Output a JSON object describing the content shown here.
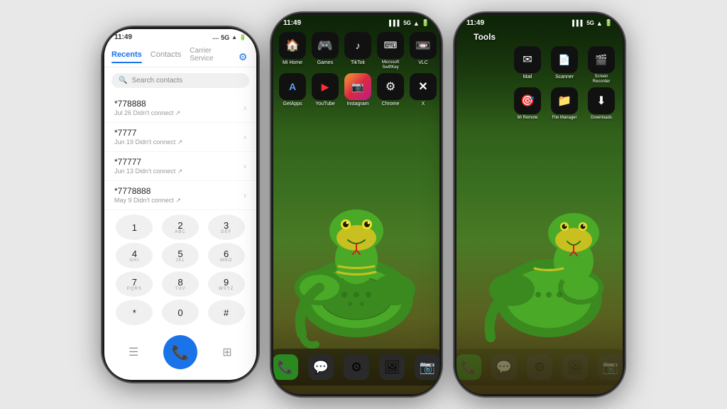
{
  "phone1": {
    "status": {
      "time": "11:49",
      "signal": "5G",
      "battery": "▓▓▓"
    },
    "tabs": [
      "Recents",
      "Contacts",
      "Carrier Service"
    ],
    "activeTab": 0,
    "searchPlaceholder": "Search contacts",
    "calls": [
      {
        "number": "*778888",
        "detail": "Jul 26 Didn't connect ↗"
      },
      {
        "number": "*7777",
        "detail": "Jun 19 Didn't connect ↗"
      },
      {
        "number": "*77777",
        "detail": "Jun 13 Didn't connect ↗"
      },
      {
        "number": "*7778888",
        "detail": "May 9 Didn't connect ↗"
      }
    ],
    "keypad": [
      [
        {
          "num": "1",
          "sub": ""
        },
        {
          "num": "2",
          "sub": "ABC"
        },
        {
          "num": "3",
          "sub": "DEF"
        }
      ],
      [
        {
          "num": "4",
          "sub": "GHI"
        },
        {
          "num": "5",
          "sub": "JKL"
        },
        {
          "num": "6",
          "sub": "MNO"
        }
      ],
      [
        {
          "num": "7",
          "sub": "PQRS"
        },
        {
          "num": "8",
          "sub": "TUV"
        },
        {
          "num": "9",
          "sub": "WXYZ"
        }
      ],
      [
        {
          "num": "*",
          "sub": ""
        },
        {
          "num": "0",
          "sub": ""
        },
        {
          "num": "#",
          "sub": ""
        }
      ]
    ]
  },
  "phone2": {
    "status": {
      "time": "11:49",
      "signal": "5G"
    },
    "apps_row1": [
      {
        "icon": "🏠",
        "label": "Mi Home"
      },
      {
        "icon": "🎮",
        "label": "Games"
      },
      {
        "icon": "♪",
        "label": "TikTok"
      },
      {
        "icon": "⌨",
        "label": "Microsoft SwiftKey"
      },
      {
        "icon": "📼",
        "label": "VLC"
      }
    ],
    "apps_row2": [
      {
        "icon": "A",
        "label": "GetApps"
      },
      {
        "icon": "▶",
        "label": "YouTube"
      },
      {
        "icon": "📷",
        "label": "Instagram"
      },
      {
        "icon": "⚙",
        "label": "Chrome"
      },
      {
        "icon": "✕",
        "label": "X"
      }
    ],
    "dock": [
      {
        "icon": "📞",
        "label": "Phone"
      },
      {
        "icon": "💬",
        "label": "Messages"
      },
      {
        "icon": "⚙",
        "label": "Settings"
      },
      {
        "icon": "🖼",
        "label": "Gallery"
      },
      {
        "icon": "📷",
        "label": "Camera"
      }
    ]
  },
  "phone3": {
    "status": {
      "time": "11:49",
      "signal": "5G"
    },
    "tools_label": "Tools",
    "tools_apps": [
      {
        "icon": "✉",
        "label": "Mail"
      },
      {
        "icon": "📄",
        "label": "Scanner"
      },
      {
        "icon": "🎬",
        "label": "Screen Recorder"
      }
    ],
    "tools_apps2": [
      {
        "icon": "🎯",
        "label": "Mi Remote"
      },
      {
        "icon": "📁",
        "label": "File Manager"
      },
      {
        "icon": "⬇",
        "label": "Downloads"
      }
    ]
  }
}
